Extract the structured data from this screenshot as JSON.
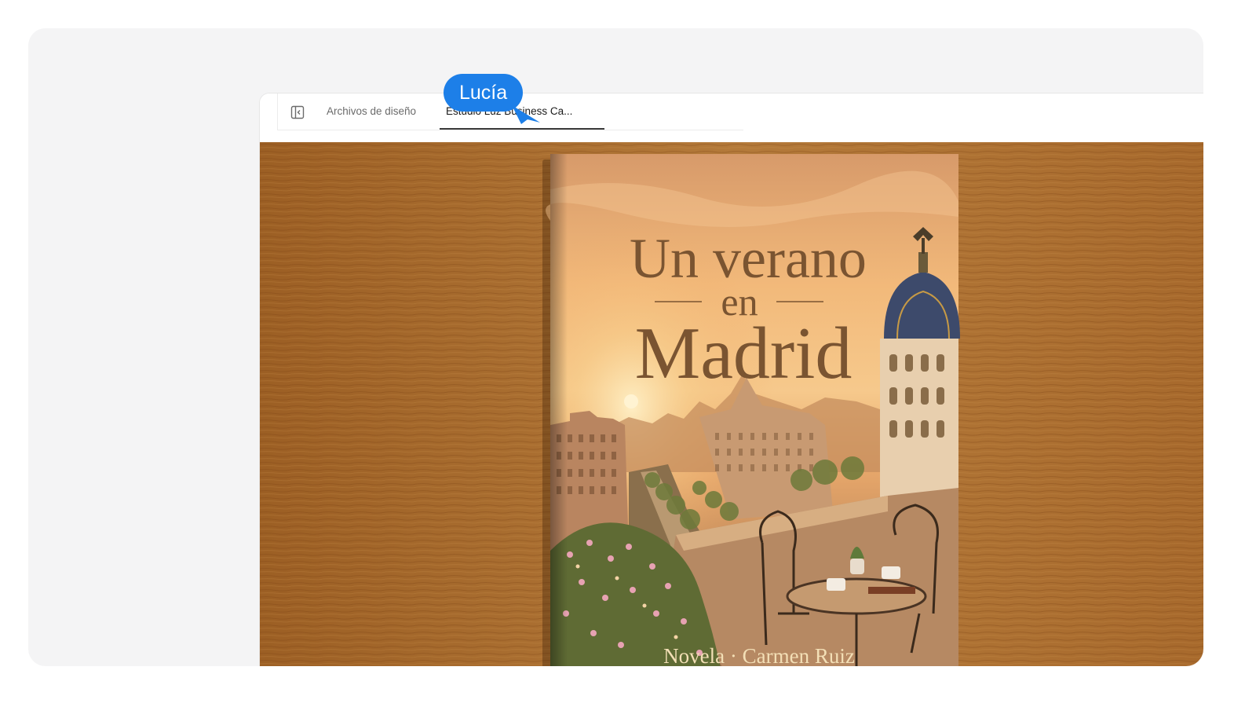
{
  "tabbar": {
    "tab_files": "Archivos de diseño",
    "tab_active": "Estudio Luz Business Ca..."
  },
  "collaborator": {
    "name": "Lucía",
    "color": "#1d7fe8"
  },
  "book": {
    "title_line1": "Un verano",
    "title_line2": "en",
    "title_line3": "Madrid",
    "byline": "Novela · Carmen Ruiz"
  },
  "icons": {
    "sidebar_toggle": "sidebar-toggle-icon",
    "cursor": "cursor-arrow-icon"
  }
}
